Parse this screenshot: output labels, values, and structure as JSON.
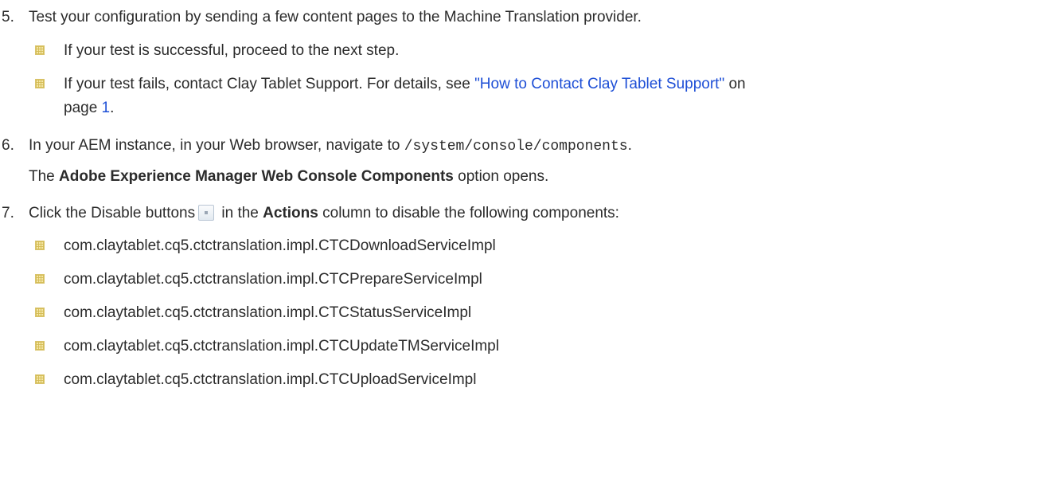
{
  "steps": [
    {
      "number": "5.",
      "text": "Test your configuration by sending a few content pages to the Machine Translation provider.",
      "bullets": [
        {
          "text": "If your test is successful, proceed to the next step."
        },
        {
          "text_before": "If your test fails, contact Clay Tablet Support. For details, see ",
          "link_text": "\"How to Contact Clay Tablet Support\"",
          "text_after": " on",
          "line2_before": "page ",
          "page_link": "1",
          "line2_after": "."
        }
      ]
    },
    {
      "number": "6.",
      "text_before": "In your AEM instance, in your Web browser, navigate to ",
      "code": "/system/console/components",
      "text_after": ".",
      "result_bold": "Adobe Experience Manager Web Console Components",
      "result_after": " option opens.",
      "result_before": "The "
    },
    {
      "number": "7.",
      "text_before": "Click the Disable buttons",
      "text_mid": " in the ",
      "bold": "Actions",
      "text_after": " column to disable the following components:",
      "components": [
        "com.claytablet.cq5.ctctranslation.impl.CTCDownloadServiceImpl",
        "com.claytablet.cq5.ctctranslation.impl.CTCPrepareServiceImpl",
        "com.claytablet.cq5.ctctranslation.impl.CTCStatusServiceImpl",
        "com.claytablet.cq5.ctctranslation.impl.CTCUpdateTMServiceImpl",
        "com.claytablet.cq5.ctctranslation.impl.CTCUploadServiceImpl"
      ]
    }
  ],
  "icons": {
    "bullet": "bullet-square-icon",
    "disable_button": "disable-button-icon"
  },
  "colors": {
    "text": "#2b2b2b",
    "link": "#1e4fd6",
    "bullet": "#f4e7a6"
  }
}
